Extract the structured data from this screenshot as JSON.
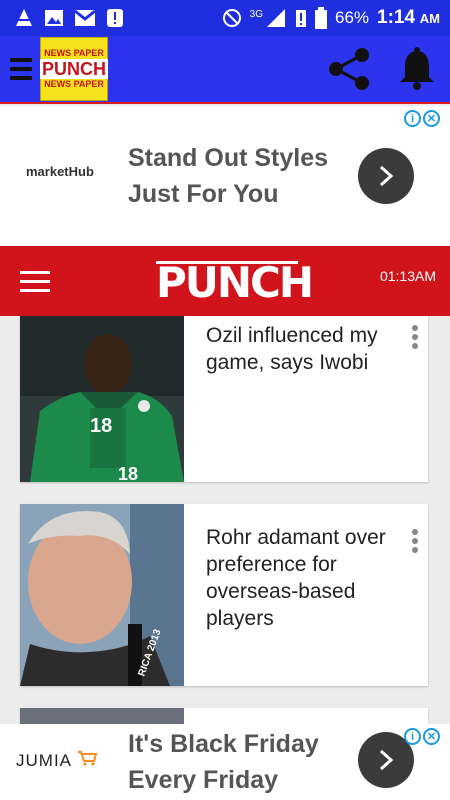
{
  "status_bar": {
    "signal": "3G",
    "battery": "66%",
    "time": "1:14",
    "ampm": "AM"
  },
  "app_bar": {
    "logo_top": "NEWS PAPER",
    "logo_main": "PUNCH",
    "logo_bottom": "NEWS PAPER",
    "share_icon": "share-icon",
    "bell_icon": "bell-icon"
  },
  "ad_top": {
    "brand": "marketHub",
    "tagline": "Stand Out Styles Just For You",
    "adchoice_i": "i",
    "adchoice_x": "✕"
  },
  "punch_header": {
    "brand": "PUNCH",
    "time": "01:13AM"
  },
  "articles": [
    {
      "headline": "Ozil influenced my game, says Iwobi",
      "jersey": "18"
    },
    {
      "headline": "Rohr adamant over preference for overseas-based players",
      "lanyard": "RICA 2013"
    }
  ],
  "ad_bottom": {
    "brand": "JUMIA",
    "tagline": "It's Black Friday Every Friday",
    "adchoice_i": "i",
    "adchoice_x": "✕"
  },
  "colors": {
    "status_bar": "#1f2fe0",
    "app_bar": "#2d34ef",
    "punch_red": "#d1131b"
  }
}
